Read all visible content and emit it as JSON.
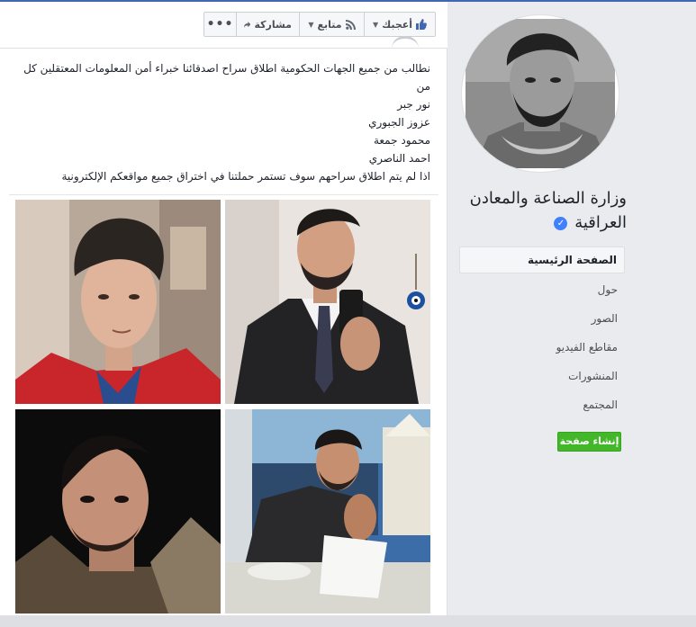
{
  "action_bar": {
    "more_label": "•••",
    "share_label": "مشاركة",
    "follow_label": "متابع",
    "like_label": "أعجبك"
  },
  "post": {
    "lines": [
      "نطالب من جميع الجهات الحكومية اطلاق سراح اصدقائنا خبراء أمن المعلومات المعتقلين كل من",
      "نور جبر",
      "عزوز الجبوري",
      "محمود جمعة",
      "احمد الناصري",
      "اذا لم يتم اطلاق سراحهم سوف تستمر حملتنا في اختراق جميع مواقعكم الإلكترونية"
    ]
  },
  "page": {
    "name": "وزارة الصناعة والمعادن العراقية",
    "verified_mark": "✓"
  },
  "nav": {
    "items": [
      {
        "label": "الصفحة الرئيسية"
      },
      {
        "label": "حول"
      },
      {
        "label": "الصور"
      },
      {
        "label": "مقاطع الفيديو"
      },
      {
        "label": "المنشورات"
      },
      {
        "label": "المجتمع"
      }
    ]
  },
  "create_page_label": "إنشاء صفحة",
  "colors": {
    "accent": "#4267b2",
    "create_button": "#42b72a",
    "verified": "#4080ff"
  }
}
